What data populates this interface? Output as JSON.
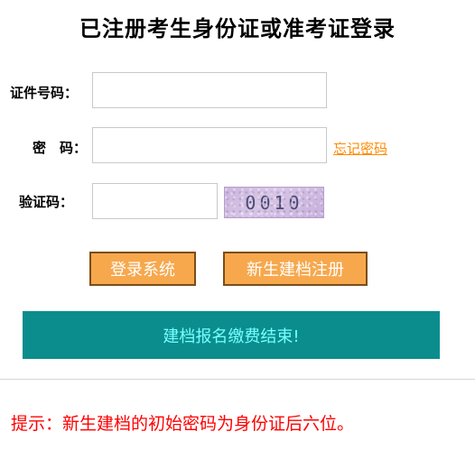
{
  "page_title": "已注册考生身份证或准考证登录",
  "form": {
    "id_label": "证件号码：",
    "id_value": "",
    "password_label": "密　码：",
    "password_value": "",
    "forgot_password_link": "忘记密码",
    "captcha_label": "验证码：",
    "captcha_value": "",
    "captcha_image_text": "0010"
  },
  "buttons": {
    "login": "登录系统",
    "register": "新生建档注册"
  },
  "banner": "建档报名缴费结束!",
  "tip": "提示：新生建档的初始密码为身份证后六位。",
  "colors": {
    "button_bg": "#f7a84d",
    "button_border": "#7a4d1a",
    "banner_bg": "#0b8d8d",
    "banner_text": "#75ffff",
    "link": "#ff8a00",
    "tip": "#ff0000"
  }
}
